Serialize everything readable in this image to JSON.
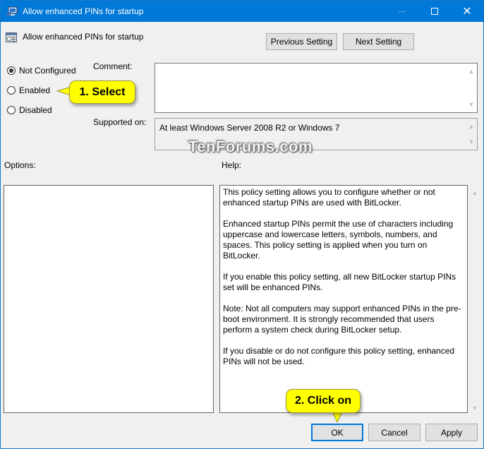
{
  "window": {
    "title": "Allow enhanced PINs for startup",
    "accent_color": "#0078d7",
    "controls": {
      "minimize": "minimize",
      "maximize": "maximize",
      "close": "✕"
    }
  },
  "header": {
    "policy_name": "Allow enhanced PINs for startup",
    "previous_setting_label": "Previous Setting",
    "next_setting_label": "Next Setting"
  },
  "state": {
    "options": [
      {
        "label": "Not Configured",
        "checked": true
      },
      {
        "label": "Enabled",
        "checked": false
      },
      {
        "label": "Disabled",
        "checked": false
      }
    ]
  },
  "comment": {
    "label": "Comment:",
    "value": ""
  },
  "supported_on": {
    "label": "Supported on:",
    "value": "At least Windows Server 2008 R2 or Windows 7"
  },
  "options_label": "Options:",
  "help": {
    "label": "Help:",
    "paragraphs": [
      "This policy setting allows you to configure whether or not enhanced startup PINs are used with BitLocker.",
      "Enhanced startup PINs permit the use of characters including uppercase and lowercase letters, symbols, numbers, and spaces. This policy setting is applied when you turn on BitLocker.",
      "If you enable this policy setting, all new BitLocker startup PINs set will be enhanced PINs.",
      "Note:   Not all computers may support enhanced PINs in the pre-boot environment. It is strongly recommended that users perform a system check during BitLocker setup.",
      "If you disable or do not configure this policy setting, enhanced PINs will not be used."
    ]
  },
  "footer": {
    "ok_label": "OK",
    "cancel_label": "Cancel",
    "apply_label": "Apply"
  },
  "annotations": {
    "callout_1": "1. Select",
    "callout_2": "2. Click on",
    "callout_color": "#ffff00",
    "watermark": "TenForums.com"
  }
}
